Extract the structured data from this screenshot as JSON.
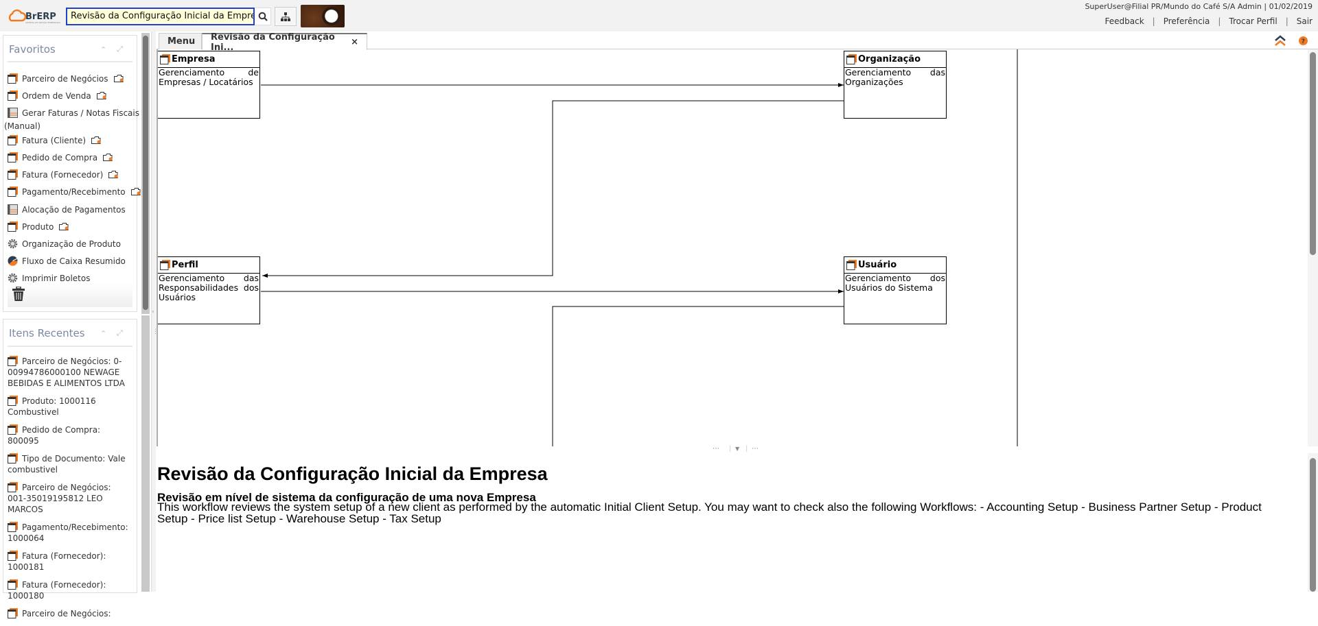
{
  "header": {
    "logo_text": "BrERP",
    "search_value": "Revisão da Configuração Inicial da Empresa",
    "user_info": "SuperUser@Filial PR/Mundo do Café S/A Admin | 01/02/2019",
    "links": [
      "Feedback",
      "Preferência",
      "Trocar Perfil",
      "Sair"
    ]
  },
  "favorites": {
    "title": "Favoritos",
    "items": [
      {
        "label": "Parceiro de Negócios",
        "icon": "window",
        "folder": true
      },
      {
        "label": "Ordem de Venda",
        "icon": "window",
        "folder": true
      },
      {
        "label": "Gerar Faturas / Notas Fiscais",
        "label2": "(Manual)",
        "icon": "form",
        "folder": false
      },
      {
        "label": "Fatura (Cliente)",
        "icon": "window",
        "folder": true
      },
      {
        "label": "Pedido de Compra",
        "icon": "window",
        "folder": true
      },
      {
        "label": "Fatura (Fornecedor)",
        "icon": "window",
        "folder": true
      },
      {
        "label": "Pagamento/Recebimento",
        "icon": "window",
        "folder": true
      },
      {
        "label": "Alocação de Pagamentos",
        "icon": "form",
        "folder": false
      },
      {
        "label": "Produto",
        "icon": "window",
        "folder": true
      },
      {
        "label": "Organização de Produto",
        "icon": "gear",
        "folder": false
      },
      {
        "label": "Fluxo de Caixa Resumido",
        "icon": "pie",
        "folder": false
      },
      {
        "label": "Imprimir Boletos",
        "icon": "gear",
        "folder": false
      }
    ]
  },
  "recent": {
    "title": "Itens Recentes",
    "items": [
      "Parceiro de Negócios: 0-00994786000100 NEWAGE BEBIDAS E ALIMENTOS LTDA",
      "Produto: 1000116 Combustivel",
      "Pedido de Compra: 800095",
      "Tipo de Documento: Vale combustivel",
      "Parceiro de Negócios: 001-35019195812 LEO MARCOS",
      "Pagamento/Recebimento: 1000064",
      "Fatura (Fornecedor): 1000181",
      "Fatura (Fornecedor): 1000180",
      "Parceiro de Negócios:"
    ]
  },
  "tabs": [
    {
      "label": "Menu",
      "active": false
    },
    {
      "label": "Revisão da Configuração Ini...",
      "active": true,
      "close": "×"
    }
  ],
  "workflow": {
    "nodes": [
      {
        "title": "Empresa",
        "desc": "Gerenciamento de Empresas / Locatários"
      },
      {
        "title": "Organização",
        "desc": "Gerenciamento das Organizações"
      },
      {
        "title": "Perfil",
        "desc": "Gerenciamento das Responsabilidades dos Usuários"
      },
      {
        "title": "Usuário",
        "desc": "Gerenciamento dos Usuários do Sistema"
      }
    ]
  },
  "description": {
    "title": "Revisão da Configuração Inicial da Empresa",
    "subtitle": "Revisão em nível de sistema da configuração de uma nova Empresa",
    "text": "This workflow reviews the system setup of a new client as performed by the automatic Initial Client Setup. You may want to check also the following Workflows: - Accounting Setup - Business Partner Setup - Product Setup - Price list Setup - Warehouse Setup - Tax Setup"
  },
  "colors": {
    "accent": "#f47a20",
    "dark": "#2d3e50",
    "search_border": "#1f3fd6",
    "search_bg": "#ffffd8"
  }
}
